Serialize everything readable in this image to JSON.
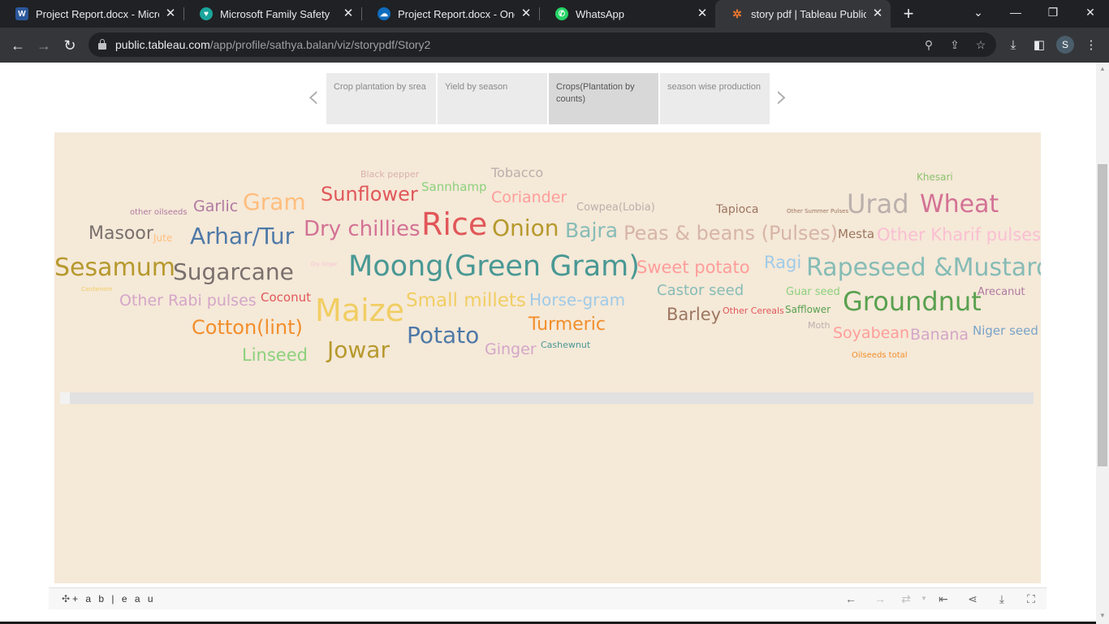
{
  "browser": {
    "tabs": [
      {
        "title": "Project Report.docx - Microsoft Word",
        "icon": "word-icon",
        "color": "#2b579a",
        "glyph": "W"
      },
      {
        "title": "Microsoft Family Safety",
        "icon": "family-safety-icon",
        "color": "#1aa59b",
        "glyph": "♥"
      },
      {
        "title": "Project Report.docx - OneDrive",
        "icon": "onedrive-icon",
        "color": "#0f6cbd",
        "glyph": "☁"
      },
      {
        "title": "WhatsApp",
        "icon": "whatsapp-icon",
        "color": "#25d366",
        "glyph": "✆"
      },
      {
        "title": "story pdf | Tableau Public",
        "icon": "tableau-icon",
        "color": "#e8762d",
        "glyph": "✲"
      }
    ],
    "url_host": "public.tableau.com",
    "url_path": "/app/profile/sathya.balan/viz/storypdf/Story2",
    "profile_initial": "S"
  },
  "story": {
    "points": [
      {
        "label": "Crop plantation by srea",
        "active": false
      },
      {
        "label": "Yield by season",
        "active": false
      },
      {
        "label": "Crops(Plantation by counts)",
        "active": true
      },
      {
        "label": "season wise production",
        "active": false
      }
    ]
  },
  "viz": {
    "type": "word cloud",
    "background": "#f5e9d8",
    "words": [
      {
        "text": "Black pepper",
        "color": "#d9b0ac",
        "size": 11
      },
      {
        "text": "Tobacco",
        "color": "#bab0ac",
        "size": 16
      },
      {
        "text": "Khesari",
        "color": "#8cc26f",
        "size": 12
      },
      {
        "text": "Sannhamp",
        "color": "#8cd17d",
        "size": 15
      },
      {
        "text": "Sunflower",
        "color": "#e15759",
        "size": 24
      },
      {
        "text": "Coriander",
        "color": "#ff9d9a",
        "size": 19
      },
      {
        "text": "Garlic",
        "color": "#b07aa1",
        "size": 19
      },
      {
        "text": "Gram",
        "color": "#ffbe7d",
        "size": 28
      },
      {
        "text": "Cowpea(Lobia)",
        "color": "#bab0ac",
        "size": 13
      },
      {
        "text": "Tapioca",
        "color": "#9d7660",
        "size": 14
      },
      {
        "text": "Other Summer Pulses",
        "color": "#9d7660",
        "size": 7
      },
      {
        "text": "Urad",
        "color": "#bab0ac",
        "size": 32
      },
      {
        "text": "Wheat",
        "color": "#d37295",
        "size": 30
      },
      {
        "text": "other oilseeds",
        "color": "#b07aa1",
        "size": 10
      },
      {
        "text": "Rice",
        "color": "#e15759",
        "size": 38
      },
      {
        "text": "Masoor",
        "color": "#79706e",
        "size": 22
      },
      {
        "text": "Jute",
        "color": "#ffbe7d",
        "size": 12
      },
      {
        "text": "Arhar/Tur",
        "color": "#4e79a7",
        "size": 28
      },
      {
        "text": "Dry chillies",
        "color": "#d37295",
        "size": 26
      },
      {
        "text": "Onion",
        "color": "#b6992d",
        "size": 28
      },
      {
        "text": "Bajra",
        "color": "#86bcb6",
        "size": 25
      },
      {
        "text": "Peas & beans (Pulses)",
        "color": "#d7b5a6",
        "size": 24
      },
      {
        "text": "Mesta",
        "color": "#9d7660",
        "size": 15
      },
      {
        "text": "Other Kharif pulses",
        "color": "#fabfd2",
        "size": 21
      },
      {
        "text": "Sesamum",
        "color": "#b6992d",
        "size": 30
      },
      {
        "text": "Sugarcane",
        "color": "#79706e",
        "size": 28
      },
      {
        "text": "Dry Ginger",
        "color": "#fabfd2",
        "size": 6
      },
      {
        "text": "Moong(Green Gram)",
        "color": "#499894",
        "size": 35
      },
      {
        "text": "Sweet potato",
        "color": "#ff9d9a",
        "size": 21
      },
      {
        "text": "Ragi",
        "color": "#a0cbe8",
        "size": 21
      },
      {
        "text": "Rapeseed &Mustard",
        "color": "#86bcb6",
        "size": 30
      },
      {
        "text": "Cardamom",
        "color": "#f1ce63",
        "size": 7
      },
      {
        "text": "Coconut",
        "color": "#e15759",
        "size": 15
      },
      {
        "text": "Castor seed",
        "color": "#86bcb6",
        "size": 18
      },
      {
        "text": "Guar seed",
        "color": "#8cd17d",
        "size": 13
      },
      {
        "text": "Arecanut",
        "color": "#b07aa1",
        "size": 13
      },
      {
        "text": "Other Rabi pulses",
        "color": "#d4a6c8",
        "size": 19
      },
      {
        "text": "Maize",
        "color": "#f1ce63",
        "size": 38
      },
      {
        "text": "Small millets",
        "color": "#f1ce63",
        "size": 23
      },
      {
        "text": "Horse-gram",
        "color": "#a0cbe8",
        "size": 20
      },
      {
        "text": "Groundnut",
        "color": "#59a14f",
        "size": 32
      },
      {
        "text": "Barley",
        "color": "#9d7660",
        "size": 21
      },
      {
        "text": "Other Cereals",
        "color": "#e15759",
        "size": 11
      },
      {
        "text": "Safflower",
        "color": "#59a14f",
        "size": 12
      },
      {
        "text": "Cotton(lint)",
        "color": "#f28e2b",
        "size": 24
      },
      {
        "text": "Potato",
        "color": "#4e79a7",
        "size": 28
      },
      {
        "text": "Turmeric",
        "color": "#f28e2b",
        "size": 22
      },
      {
        "text": "Moth",
        "color": "#bab0ac",
        "size": 11
      },
      {
        "text": "Soyabean",
        "color": "#ff9d9a",
        "size": 19
      },
      {
        "text": "Banana",
        "color": "#d4a6c8",
        "size": 19
      },
      {
        "text": "Niger seed",
        "color": "#79a3c8",
        "size": 15
      },
      {
        "text": "Linseed",
        "color": "#8cd17d",
        "size": 21
      },
      {
        "text": "Jowar",
        "color": "#b6992d",
        "size": 28
      },
      {
        "text": "Ginger",
        "color": "#d4a6c8",
        "size": 19
      },
      {
        "text": "Cashewnut",
        "color": "#499894",
        "size": 11
      },
      {
        "text": "Oilseeds total",
        "color": "#f28e2b",
        "size": 10
      }
    ]
  },
  "footer": {
    "brand": "+ a b | e a u",
    "icons": [
      "undo-icon",
      "redo-icon",
      "revert-icon",
      "reset-icon",
      "share-icon",
      "download-icon",
      "fullscreen-icon"
    ]
  }
}
